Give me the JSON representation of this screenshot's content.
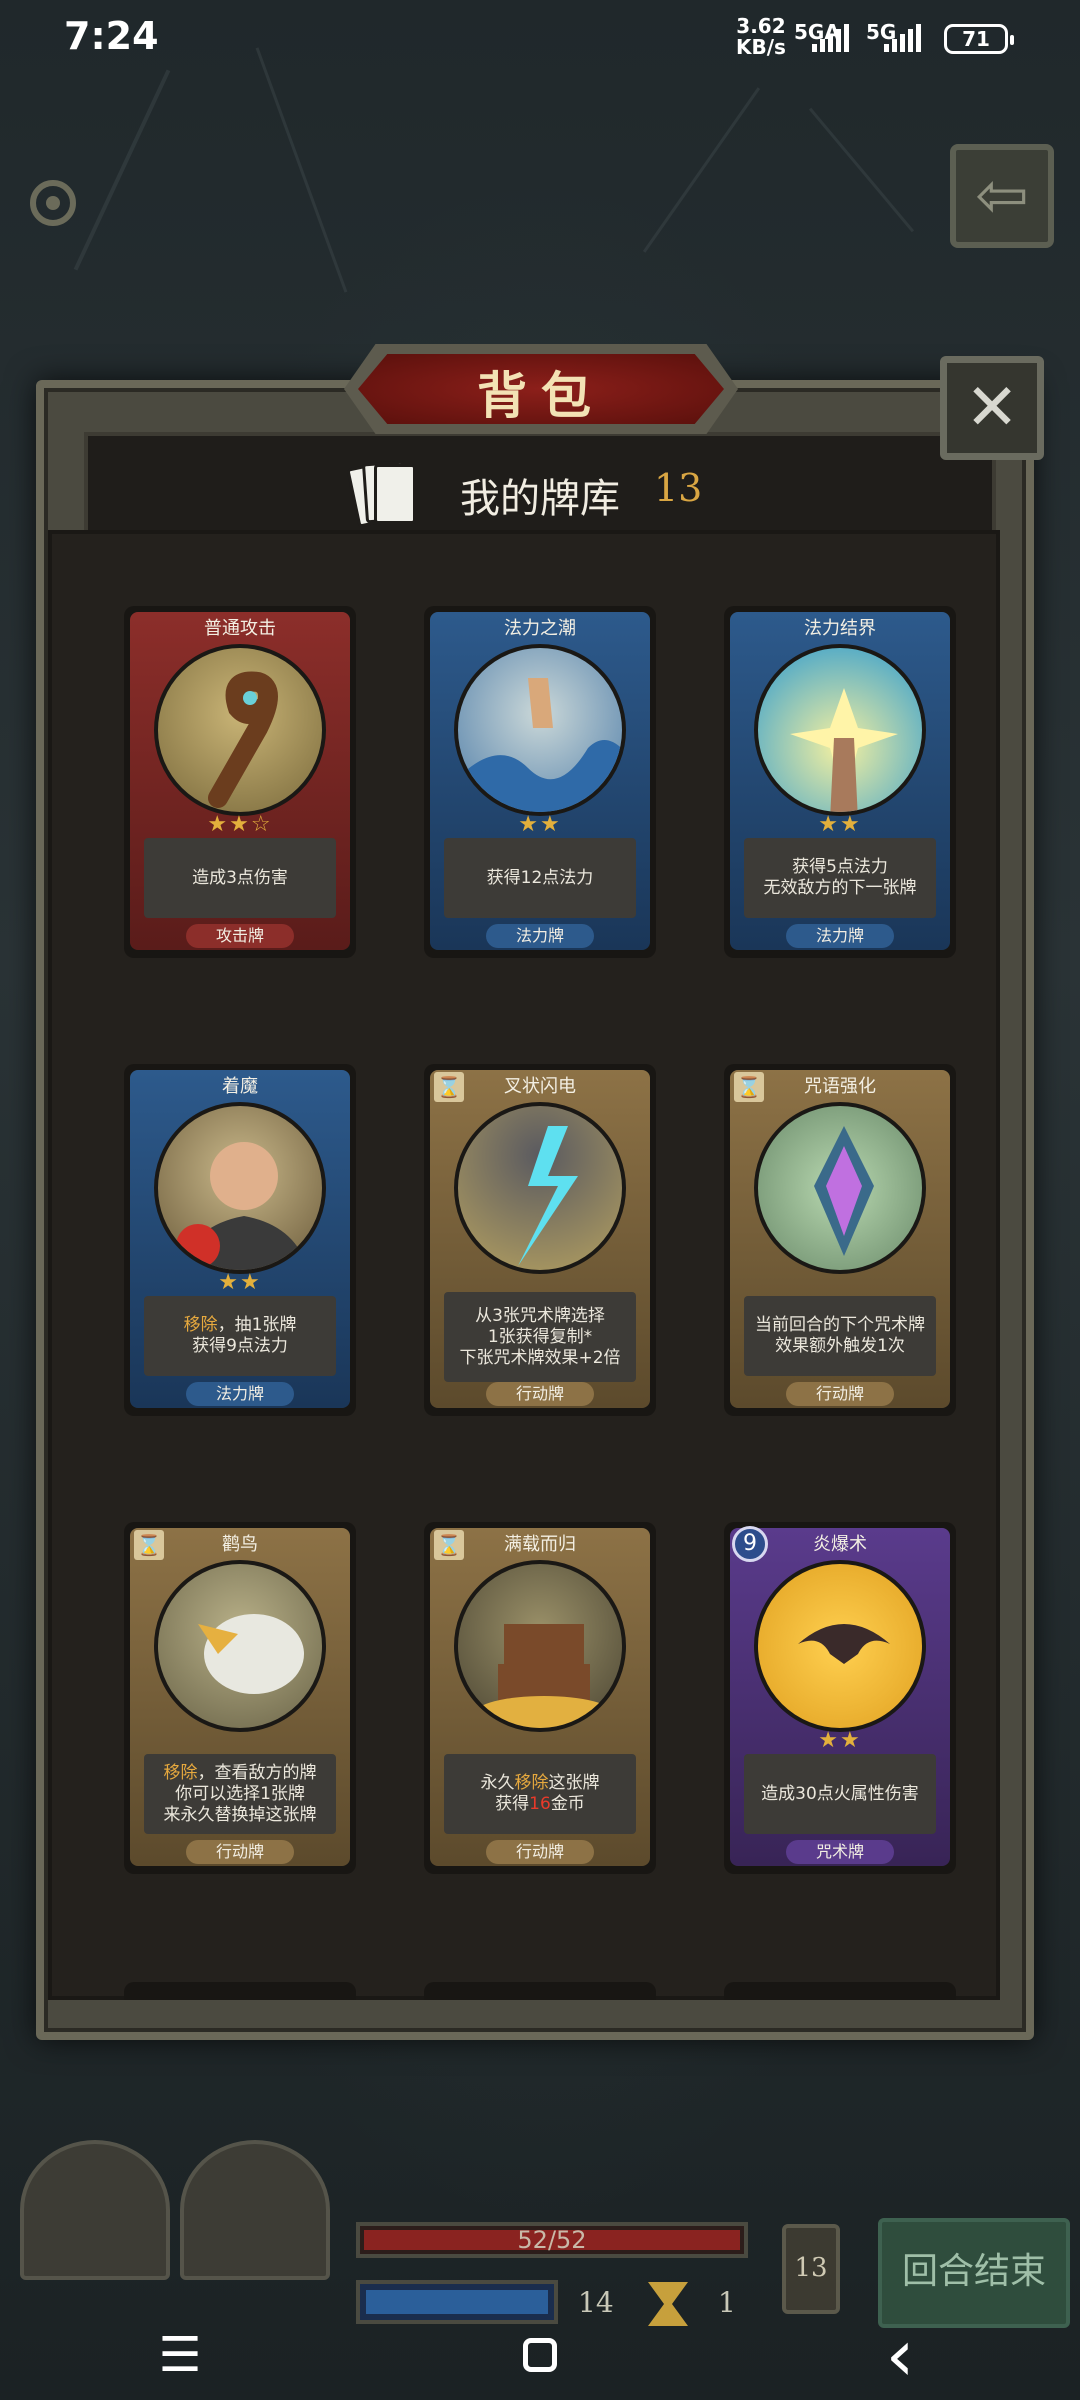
{
  "status_bar": {
    "time": "7:24",
    "net_speed_value": "3.62",
    "net_speed_unit": "KB/s",
    "signal1": "5GA",
    "signal2": "5G",
    "battery": "71"
  },
  "dialog": {
    "title": "背包",
    "deck_title": "我的牌库",
    "deck_count": "13"
  },
  "cards": [
    {
      "name": "普通攻击",
      "desc": "造成3点伤害",
      "type": "攻击牌",
      "stars": "★★☆"
    },
    {
      "name": "法力之潮",
      "desc": "获得12点法力",
      "type": "法力牌",
      "stars": "★★"
    },
    {
      "name": "法力结界",
      "desc": "获得5点法力\n无效敌方的下一张牌",
      "type": "法力牌",
      "stars": "★★"
    },
    {
      "name": "着魔",
      "desc_hl": "移除",
      "desc_rest": "，抽1张牌\n获得9点法力",
      "type": "法力牌",
      "stars": "★★"
    },
    {
      "name": "叉状闪电",
      "desc": "从3张咒术牌选择\n1张获得复制*\n下张咒术牌效果+2倍",
      "type": "行动牌",
      "stars": ""
    },
    {
      "name": "咒语强化",
      "desc": "当前回合的下个咒术牌\n效果额外触发1次",
      "type": "行动牌",
      "stars": ""
    },
    {
      "name": "鹳鸟",
      "desc_hl": "移除",
      "desc_rest": "，查看敌方的牌\n你可以选择1张牌\n来永久替换掉这张牌",
      "type": "行动牌",
      "stars": ""
    },
    {
      "name": "满载而归",
      "desc_pre": "永久",
      "desc_hl": "移除",
      "desc_mid": "这张牌\n获得",
      "desc_num": "16",
      "desc_post": "金币",
      "type": "行动牌",
      "stars": ""
    },
    {
      "name": "炎爆术",
      "cost": "9",
      "desc": "造成30点火属性伤害",
      "type": "咒术牌",
      "stars": "★★"
    }
  ],
  "hud": {
    "hp": "52/52",
    "mana": "14",
    "turn": "1",
    "pile_count": "13",
    "end_turn": "回合结束"
  },
  "navbar": {
    "menu": "☰",
    "back": "‹"
  },
  "colors": {
    "attack": "#8c2e2a",
    "mana": "#2d5a8c",
    "action": "#8d7246",
    "spell": "#5a3b8c",
    "highlight": "#e7a93e"
  }
}
